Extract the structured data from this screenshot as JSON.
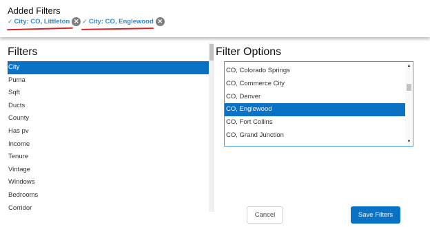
{
  "added_filters": {
    "title": "Added Filters",
    "chips": [
      {
        "label": "City: CO, Littleton",
        "check_icon": "check-icon",
        "remove_icon": "close-icon"
      },
      {
        "label": "City: CO, Englewood",
        "check_icon": "check-icon",
        "remove_icon": "close-icon"
      }
    ],
    "chip_color": "#2a8bd8",
    "annotation_color": "#d9232b"
  },
  "filters": {
    "title": "Filters",
    "items": [
      "City",
      "Puma",
      "Sqft",
      "Ducts",
      "County",
      "Has pv",
      "Income",
      "Tenure",
      "Vintage",
      "Windows",
      "Bedrooms",
      "Corridor"
    ],
    "selected": "City"
  },
  "filter_options": {
    "title": "Filter Options",
    "items": [
      "CO, Colorado Springs",
      "CO, Commerce City",
      "CO, Denver",
      "CO, Englewood",
      "CO, Fort Collins",
      "CO, Grand Junction"
    ],
    "selected": "CO, Englewood"
  },
  "buttons": {
    "cancel": "Cancel",
    "save": "Save Filters"
  },
  "colors": {
    "accent": "#0a72c4",
    "selection": "#0a72c4"
  }
}
